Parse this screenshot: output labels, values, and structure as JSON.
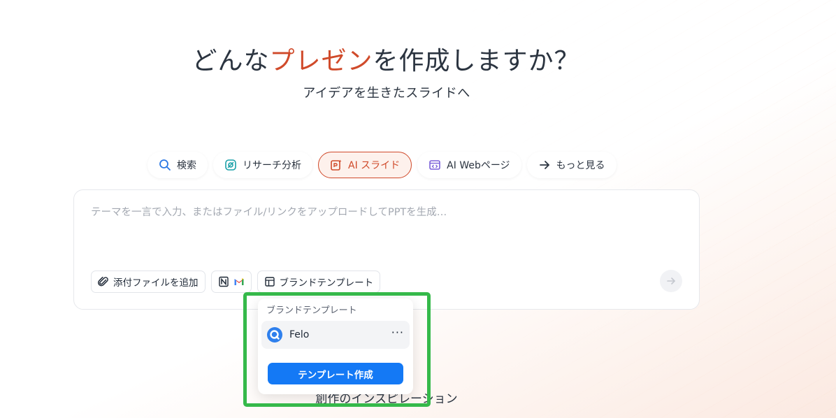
{
  "hero": {
    "title_before": "どんな",
    "title_accent": "プレゼン",
    "title_after": "を作成しますか？",
    "subtitle": "アイデアを生きたスライドへ"
  },
  "mode_tabs": [
    {
      "label": "検索",
      "icon": "search-icon"
    },
    {
      "label": "リサーチ分析",
      "icon": "research-icon"
    },
    {
      "label": "AI スライド",
      "icon": "slide-icon",
      "active": true
    },
    {
      "label": "AI Webページ",
      "icon": "code-window-icon"
    },
    {
      "label": "もっと見る",
      "icon": "arrow-right-icon"
    }
  ],
  "composer": {
    "placeholder": "テーマを一言で入力、またはファイル/リンクをアップロードしてPPTを生成…",
    "attach_label": "添付ファイルを追加",
    "brand_template_label": "ブランドテンプレート"
  },
  "popup": {
    "title": "ブランドテンプレート",
    "item_name": "Felo",
    "more": "···",
    "create_label": "テンプレート作成"
  },
  "inspiration_label": "創作のインスピレーション",
  "colors": {
    "accent": "#d04a2a",
    "primary_button": "#1479f5",
    "highlight": "#35b94a"
  }
}
